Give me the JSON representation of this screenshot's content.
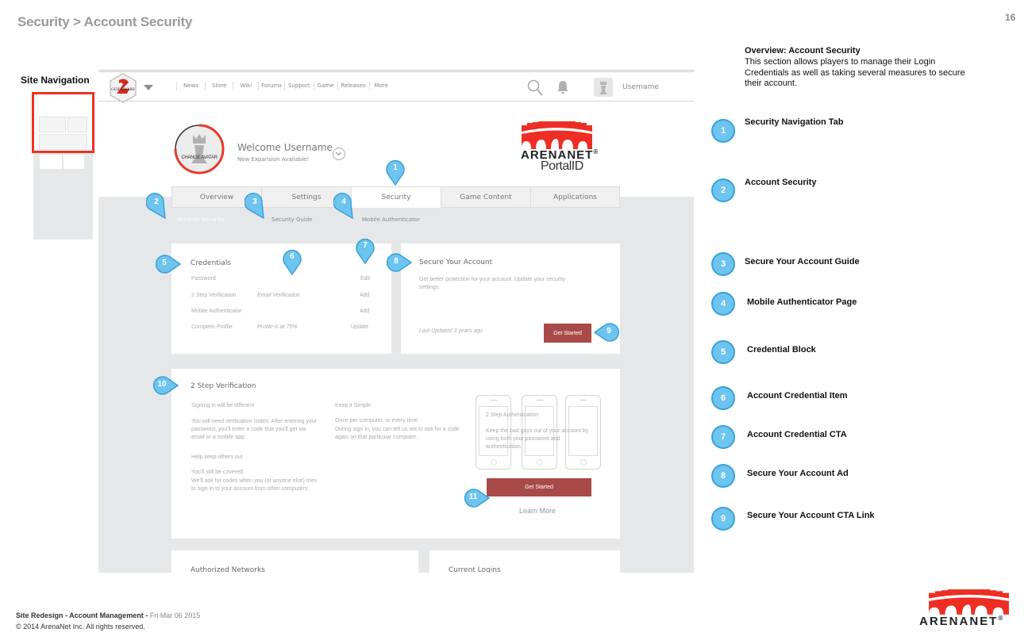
{
  "slide": {
    "title": "Security > Account Security",
    "page_number": "16",
    "site_nav_label": "Site Navigation",
    "footer": {
      "project": "Site Redesign - Account Management - ",
      "date": "Fri Mar 06 2015",
      "copyright": "© 2014 ArenaNet Inc. All rights reserved."
    },
    "brand_color": "#ee2e24",
    "marker_color": "#6dc4ef"
  },
  "mockup": {
    "header": {
      "game_logo": "GUILD WARS 2",
      "nav": [
        "News",
        "Store",
        "Wiki",
        "Forums",
        "Support",
        "Game",
        "Releases",
        "More"
      ],
      "username": "Username"
    },
    "profile": {
      "change_avatar": "CHANGE AVATAR",
      "welcome": "Welcome Username",
      "subtitle": "New Expansion Available!",
      "profile_completion": 0.75
    },
    "brand": {
      "wordmark": "ARENANET",
      "registered": "®",
      "product": "PortalID"
    },
    "tabs": [
      {
        "label": "Overview",
        "active": false
      },
      {
        "label": "Settings",
        "active": false
      },
      {
        "label": "Security",
        "active": true
      },
      {
        "label": "Game Content",
        "active": false
      },
      {
        "label": "Applications",
        "active": false
      }
    ],
    "subnav": [
      {
        "label": "Account Security",
        "active": true
      },
      {
        "label": "Security Guide",
        "active": false
      },
      {
        "label": "Mobile Authenticator",
        "active": false
      }
    ],
    "credentials": {
      "title": "Credentials",
      "rows": [
        {
          "label": "Password",
          "value": "",
          "action": "Edit"
        },
        {
          "label": "2 Step Verification",
          "value": "Email Verification",
          "action": "Add"
        },
        {
          "label": "Mobile Authenticator",
          "value": "",
          "action": "Add"
        },
        {
          "label": "Complete Profile",
          "value": "Profile is at 75%",
          "action": "Update"
        }
      ]
    },
    "secure_account": {
      "title": "Secure Your Account",
      "body": "Get better protection for your account. Update your security settings.",
      "last_updated": "Last Updated 3 years ago",
      "cta": "Get Started"
    },
    "two_step": {
      "title": "2 Step Verification",
      "col1": [
        {
          "heading": "Signing in will be different",
          "text": "You will need verification codes: After entering your password, you'll enter a code that you'll get via email or a mobile app."
        },
        {
          "heading": "Help keep others out",
          "text_line1": "You'll still be covered:",
          "text": "We'll ask for codes when you (or anyone else) tries to sign in to your account from other computers."
        }
      ],
      "col2": {
        "heading": "Keep it Simple",
        "text_line1": "Once per computer, or every time:",
        "text": "During sign in, you can tell us not to ask for a code again on that particular computer."
      },
      "phone_title": "2 Step Authentication",
      "phone_text": "Keep the bad guys out of your account by using both your password and authentication.",
      "cta": "Get Started",
      "learn_more": "Learn More"
    },
    "lower_cards": {
      "authorized_networks": "Authorized Networks",
      "current_logins": "Current Logins"
    }
  },
  "markers": [
    "1",
    "2",
    "3",
    "4",
    "5",
    "6",
    "7",
    "8",
    "9",
    "10",
    "11"
  ],
  "notes": {
    "overview_title": "Overview: Account Security",
    "overview_body": "This section allows players to manage their Login Credentials as well as taking several measures to secure their account.",
    "items": [
      {
        "num": "1",
        "label": "Security Navigation Tab"
      },
      {
        "num": "2",
        "label": "Account Security"
      },
      {
        "num": "3",
        "label": "Secure Your Account Guide"
      },
      {
        "num": "4",
        "label": "Mobile Authenticator Page"
      },
      {
        "num": "5",
        "label": "Credential Block"
      },
      {
        "num": "6",
        "label": "Account Credential Item"
      },
      {
        "num": "7",
        "label": "Account Credential CTA"
      },
      {
        "num": "8",
        "label": "Secure Your Account Ad"
      },
      {
        "num": "9",
        "label": "Secure Your Account CTA Link"
      }
    ]
  }
}
